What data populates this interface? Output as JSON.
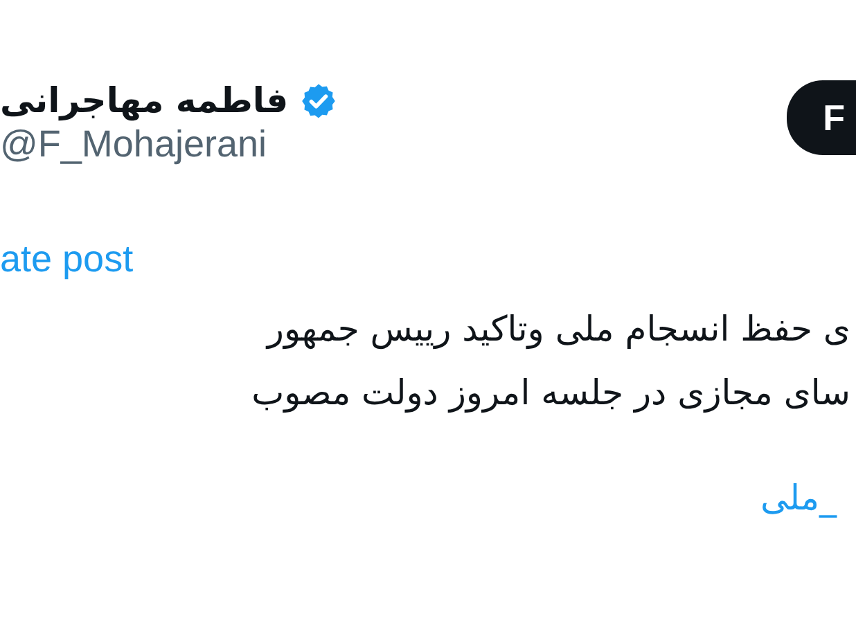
{
  "author": {
    "name": "فاطمه مهاجرانی",
    "verified": true,
    "handle": "@F_Mohajerani"
  },
  "follow_button": {
    "label": "F"
  },
  "translate_link": "ate post",
  "body_lines": [
    {
      "kind": "text",
      "text": "ی حفظ انسجام ملی وتاکید رییس جمهور"
    },
    {
      "kind": "text",
      "text": "سای مجازی در جلسه امروز دولت مصوب"
    },
    {
      "kind": "hashtag",
      "text": "_ملی"
    }
  ]
}
